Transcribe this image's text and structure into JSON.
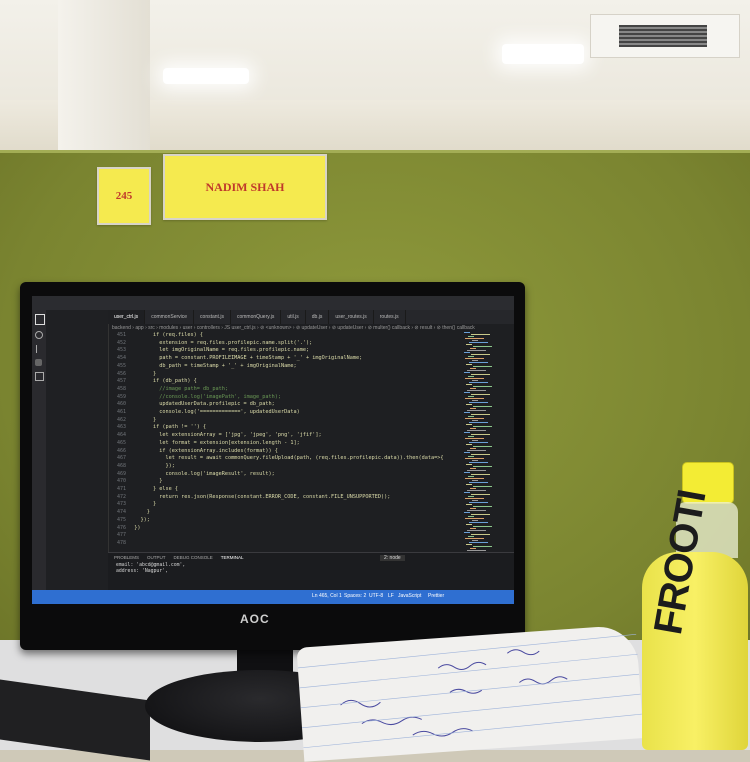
{
  "room": {
    "seat_number": "245",
    "name_plate": "NADIM SHAH"
  },
  "monitor": {
    "brand": "AOC"
  },
  "editor": {
    "tabs": [
      "user_ctrl.js",
      "commonService",
      "constant.js",
      "commonQuery.js",
      "util.js",
      "db.js",
      "user_routes.js",
      "routes.js"
    ],
    "active_tab": "user_ctrl.js",
    "breadcrumb": "backend › app › src › modules › user › controllers › JS user_ctrl.js › ⊘ <unknown> › ⊘ updateUser › ⊘ updateUser › ⊘ multer() callback › ⊘ result › ⊘ then() callback",
    "line_numbers": [
      "451",
      "452",
      "453",
      "454",
      "455",
      "456",
      "457",
      "458",
      "459",
      "460",
      "461",
      "462",
      "463",
      "464",
      "465",
      "466",
      "467",
      "468",
      "469",
      "470",
      "471",
      "472",
      "473",
      "474",
      "475",
      "476",
      "477",
      "478"
    ],
    "code_lines": [
      "        if (req.files) {",
      "          extension = req.files.profilepic.name.split('.');",
      "          let imgOriginalName = req.files.profilepic.name;",
      "          path = constant.PROFILEIMAGE + timeStamp + '_' + imgOriginalName;",
      "          db_path = timeStamp + '_' + imgOriginalName;",
      "        }",
      "        if (db_path) {",
      "          //image path= db_path;",
      "          //console.log('imagePath', image_path);",
      "          updatedUserData.profilepic = db_path;",
      "          console.log('=============', updatedUserData)",
      "        }",
      "        if (path != '') {",
      "          let extensionArray = ['jpg', 'jpeg', 'png', 'jfif'];",
      "          let format = extension[extension.length - 1];",
      "          if (extensionArray.includes(format)) {",
      "            let result = await commonQuery.fileUpload(path, (req.files.profilepic.data)).then(data=>{",
      "            });",
      "            console.log('imageResult', result);",
      "          }",
      "        } else {",
      "          return res.json(Response(constant.ERROR_CODE, constant.FILE_UNSUPPORTED));",
      "        }",
      "      }",
      "",
      "    });",
      "  })",
      ""
    ],
    "panel_tabs": [
      "PROBLEMS",
      "OUTPUT",
      "DEBUG CONSOLE",
      "TERMINAL"
    ],
    "panel_lines": [
      "email: 'abcd@gmail.com',",
      "address: 'Nagpur',"
    ],
    "terminal_dropdown": "2: node",
    "status": {
      "position": "Ln 465, Col 1",
      "spaces": "Spaces: 2",
      "encoding": "UTF-8",
      "eol": "LF",
      "language": "JavaScript",
      "formatter": "Prettier"
    }
  },
  "bottle": {
    "brand": "FROOTI"
  },
  "colors": {
    "partition": "#7f8a33",
    "sign_yellow": "#f5ea4f",
    "sign_text": "#c0392b",
    "status_blue": "#2f6fd1",
    "bottle_yellow": "#f3ec34"
  }
}
